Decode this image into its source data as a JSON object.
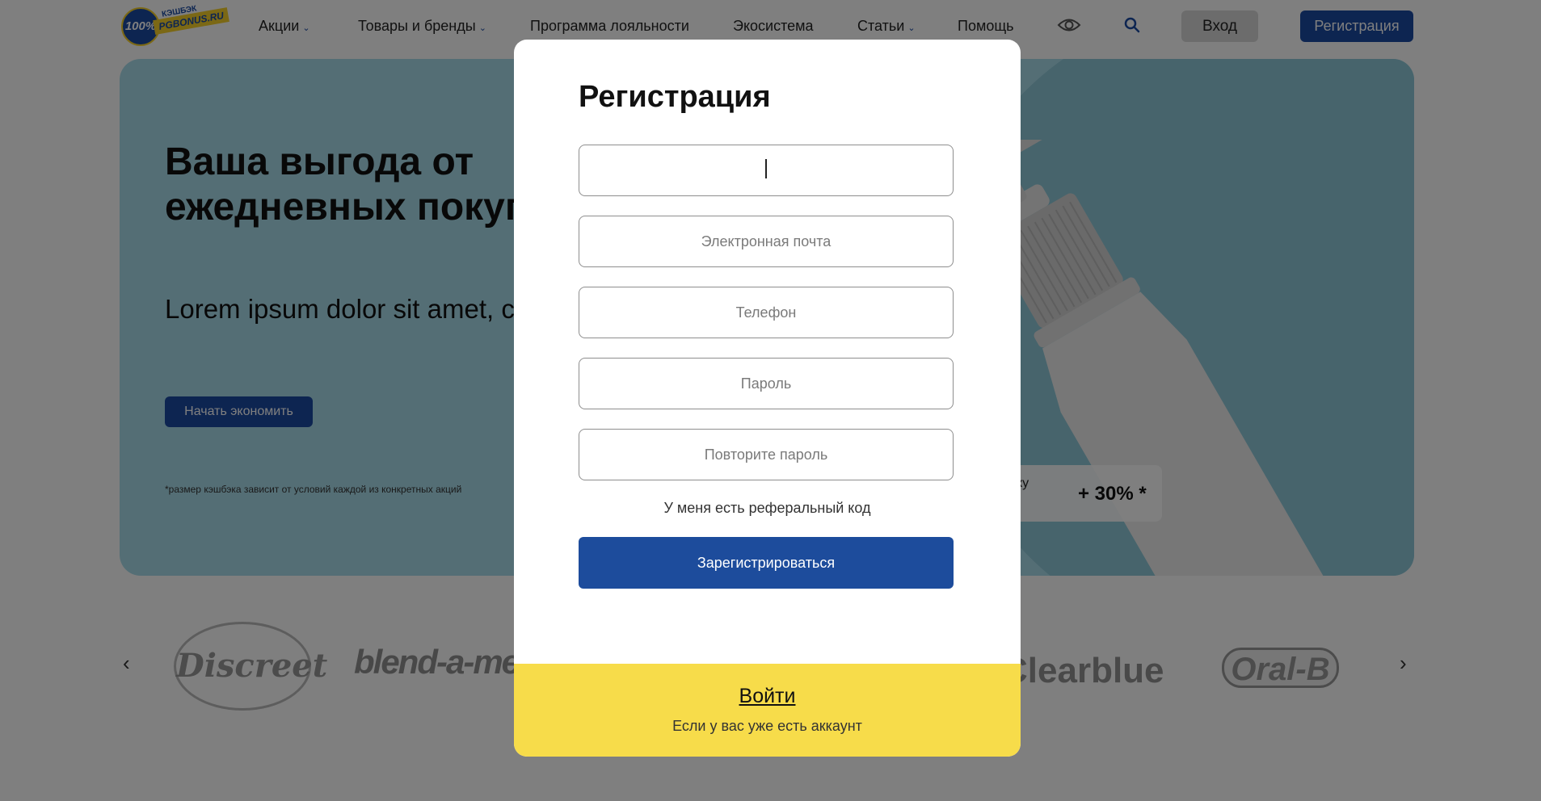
{
  "header": {
    "logo": {
      "badge": "100%",
      "top_text": "КЭШБЭК",
      "site": "PGBONUS.RU"
    },
    "nav": [
      {
        "label": "Акции",
        "has_dropdown": true
      },
      {
        "label": "Товары и бренды",
        "has_dropdown": true
      },
      {
        "label": "Программа лояльности",
        "has_dropdown": false
      },
      {
        "label": "Экосистема",
        "has_dropdown": false
      },
      {
        "label": "Статьи",
        "has_dropdown": true
      },
      {
        "label": "Помощь",
        "has_dropdown": false
      }
    ],
    "icons": {
      "accessibility": "eye-icon",
      "search": "search-icon"
    },
    "login_label": "Вход",
    "register_label": "Регистрация"
  },
  "hero": {
    "title": "Ваша выгода от ежедневных покупок",
    "subtitle": "Lorem ipsum dolor sit amet, consectetur adipiscing elit.",
    "button_label": "Начать экономить",
    "footnote": "*размер кэшбэка зависит от условий каждой из конкретных акций",
    "cashback_label": "ку",
    "cashback_value": "+ 30% *"
  },
  "brands": {
    "items": [
      "Discreet",
      "blend-a-med",
      "Clearblue",
      "Oral-B"
    ]
  },
  "modal": {
    "title": "Регистрация",
    "fields": [
      {
        "name": "name",
        "placeholder": "",
        "value": ""
      },
      {
        "name": "email",
        "placeholder": "Электронная почта",
        "value": ""
      },
      {
        "name": "phone",
        "placeholder": "Телефон",
        "value": ""
      },
      {
        "name": "password",
        "placeholder": "Пароль",
        "value": ""
      },
      {
        "name": "password_repeat",
        "placeholder": "Повторите пароль",
        "value": ""
      }
    ],
    "referral_label": "У меня есть реферальный код",
    "submit_label": "Зарегистрироваться",
    "footer": {
      "login_link": "Войти",
      "note": "Если у вас уже есть аккаунт"
    }
  },
  "colors": {
    "brand_blue": "#1b4aa3",
    "hero_bg": "#a9dcea",
    "footer_yellow": "#f7dc4a",
    "overlay": "rgba(0,0,0,0.5)"
  }
}
